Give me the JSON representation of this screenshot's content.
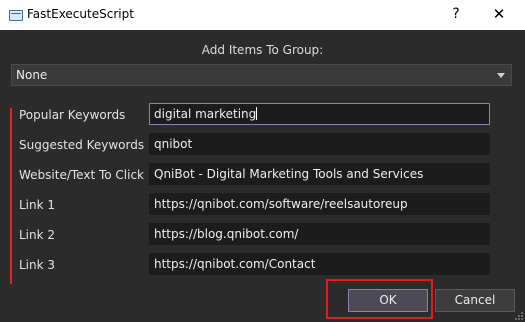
{
  "window": {
    "title": "FastExecuteScript",
    "help_glyph": "?",
    "close_glyph": "✕"
  },
  "group": {
    "label": "Add Items To Group:",
    "selected": "None"
  },
  "fields": [
    {
      "label": "Popular Keywords",
      "value": "digital marketing"
    },
    {
      "label": "Suggested Keywords",
      "value": "qnibot"
    },
    {
      "label": "Website/Text To Click",
      "value": "QniBot - Digital Marketing Tools and Services"
    },
    {
      "label": "Link 1",
      "value": "https://qnibot.com/software/reelsautoreup"
    },
    {
      "label": "Link 2",
      "value": "https://blog.qnibot.com/"
    },
    {
      "label": "Link 3",
      "value": "https://qnibot.com/Contact"
    }
  ],
  "buttons": {
    "ok": "OK",
    "cancel": "Cancel"
  },
  "colors": {
    "background": "#2b2b2b",
    "input": "#1c1c1c",
    "accent": "#8f7fb8",
    "annotation_red": "#e01c1c"
  }
}
